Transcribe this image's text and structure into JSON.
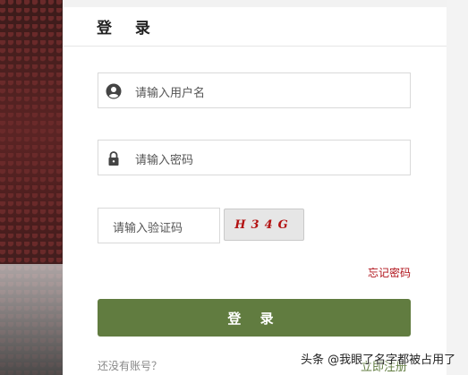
{
  "login": {
    "title": "登 录",
    "username_placeholder": "请输入用户名",
    "password_placeholder": "请输入密码",
    "captcha_placeholder": "请输入验证码",
    "captcha_text": "H34G",
    "forgot_password": "忘记密码",
    "submit_label": "登 录",
    "no_account": "还没有账号？",
    "register": "立即注册"
  },
  "watermark": "头条 @我眼了名字都被占用了",
  "colors": {
    "accent": "#617c40",
    "link_red": "#b0131b",
    "captcha_red": "#b31212"
  },
  "icons": {
    "username": "user-icon",
    "password": "lock-icon"
  }
}
